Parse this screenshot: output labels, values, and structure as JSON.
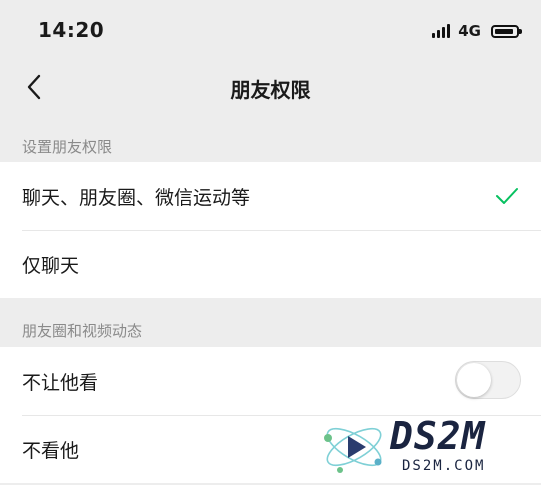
{
  "status_bar": {
    "time": "14:20",
    "network": "4G",
    "signal_icon": "signal-bars-icon",
    "battery_icon": "battery-icon"
  },
  "nav": {
    "title": "朋友权限",
    "back_icon": "chevron-left-icon"
  },
  "sections": [
    {
      "header": "设置朋友权限",
      "rows": [
        {
          "label": "聊天、朋友圈、微信运动等",
          "selected": true
        },
        {
          "label": "仅聊天",
          "selected": false
        }
      ]
    },
    {
      "header": "朋友圈和视频动态",
      "rows": [
        {
          "label": "不让他看",
          "toggle": false
        },
        {
          "label": "不看他"
        }
      ]
    }
  ],
  "colors": {
    "accent_green": "#07c160",
    "background": "#ededed",
    "row_background": "#ffffff",
    "header_text": "#8a8a8a"
  },
  "watermark": {
    "title": "DS2M",
    "subtitle": "DS2M.COM"
  }
}
